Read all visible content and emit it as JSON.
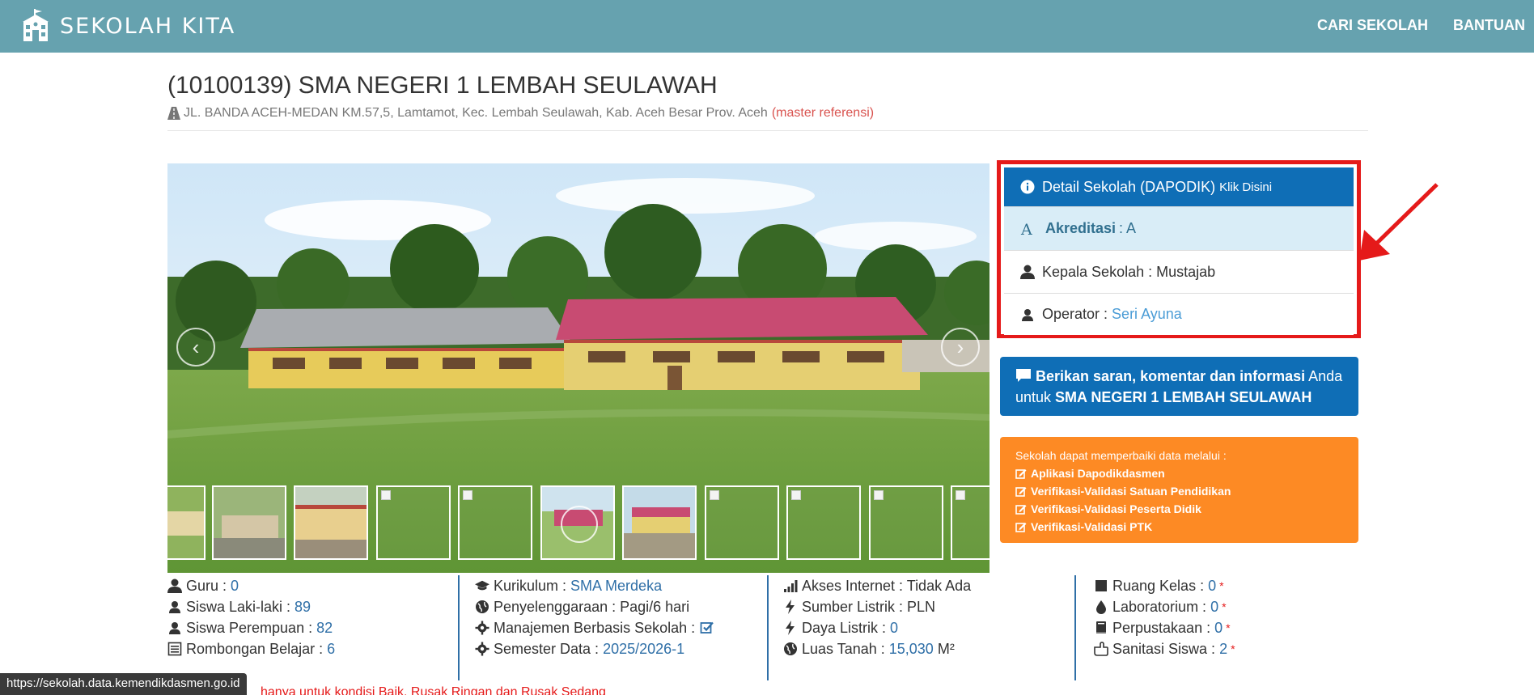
{
  "navbar": {
    "brand": "SEKOLAH KITA",
    "links": [
      "CARI SEKOLAH",
      "BANTUAN"
    ]
  },
  "header": {
    "title": "(10100139) SMA NEGERI 1 LEMBAH SEULAWAH",
    "address": "JL. BANDA ACEH-MEDAN KM.57,5, Lamtamot, Kec. Lembah Seulawah, Kab. Aceh Besar Prov. Aceh",
    "ref_link": "(master referensi)"
  },
  "detail": {
    "head_label": "Detail Sekolah (DAPODIK)",
    "head_small": "Klik Disini",
    "akreditasi_label": "Akreditasi",
    "akreditasi_value": ": A",
    "kepala": "Kepala Sekolah : Mustajab",
    "operator_label": "Operator :",
    "operator_value": "Seri Ayuna"
  },
  "feedback": {
    "bold1": "Berikan saran, komentar dan informasi",
    "text1": " Anda",
    "text2": "untuk ",
    "bold2": "SMA NEGERI 1 LEMBAH SEULAWAH"
  },
  "fix": {
    "intro": "Sekolah dapat memperbaiki data melalui :",
    "items": [
      "Aplikasi Dapodikdasmen",
      "Verifikasi-Validasi Satuan Pendidikan",
      "Verifikasi-Validasi Peserta Didik",
      "Verifikasi-Validasi PTK"
    ]
  },
  "stats": {
    "col1": [
      {
        "label": "Guru :",
        "value": "0"
      },
      {
        "label": "Siswa Laki-laki :",
        "value": "89"
      },
      {
        "label": "Siswa Perempuan :",
        "value": "82"
      },
      {
        "label": "Rombongan Belajar :",
        "value": "6"
      }
    ],
    "col2": [
      {
        "label": "Kurikulum :",
        "value": "SMA Merdeka"
      },
      {
        "label": "Penyelenggaraan : Pagi/6 hari",
        "value": ""
      },
      {
        "label": "Manajemen Berbasis Sekolah :",
        "value": ""
      },
      {
        "label": "Semester Data :",
        "value": "2025/2026-1"
      }
    ],
    "col3": [
      {
        "label": "Akses Internet : Tidak Ada",
        "value": ""
      },
      {
        "label": "Sumber Listrik : PLN",
        "value": ""
      },
      {
        "label": "Daya Listrik :",
        "value": "0"
      },
      {
        "label": "Luas Tanah :",
        "value": "15,030",
        "unit": "M²"
      }
    ],
    "col4": [
      {
        "label": "Ruang Kelas :",
        "value": "0",
        "star": "*"
      },
      {
        "label": "Laboratorium :",
        "value": "0",
        "star": "*"
      },
      {
        "label": "Perpustakaan :",
        "value": "0",
        "star": "*"
      },
      {
        "label": "Sanitasi Siswa :",
        "value": "2",
        "star": "*"
      }
    ]
  },
  "statusbar": "https://sekolah.data.kemendikdasmen.go.id",
  "note": "hanya untuk kondisi Baik, Rusak Ringan dan Rusak Sedang",
  "colors": {
    "navbar": "#66a2af",
    "primary": "#0f6eb6",
    "orange": "#fd8a24",
    "highlight": "#e51a1a"
  },
  "carousel": {
    "arrow_left": "‹",
    "arrow_right": "›"
  }
}
